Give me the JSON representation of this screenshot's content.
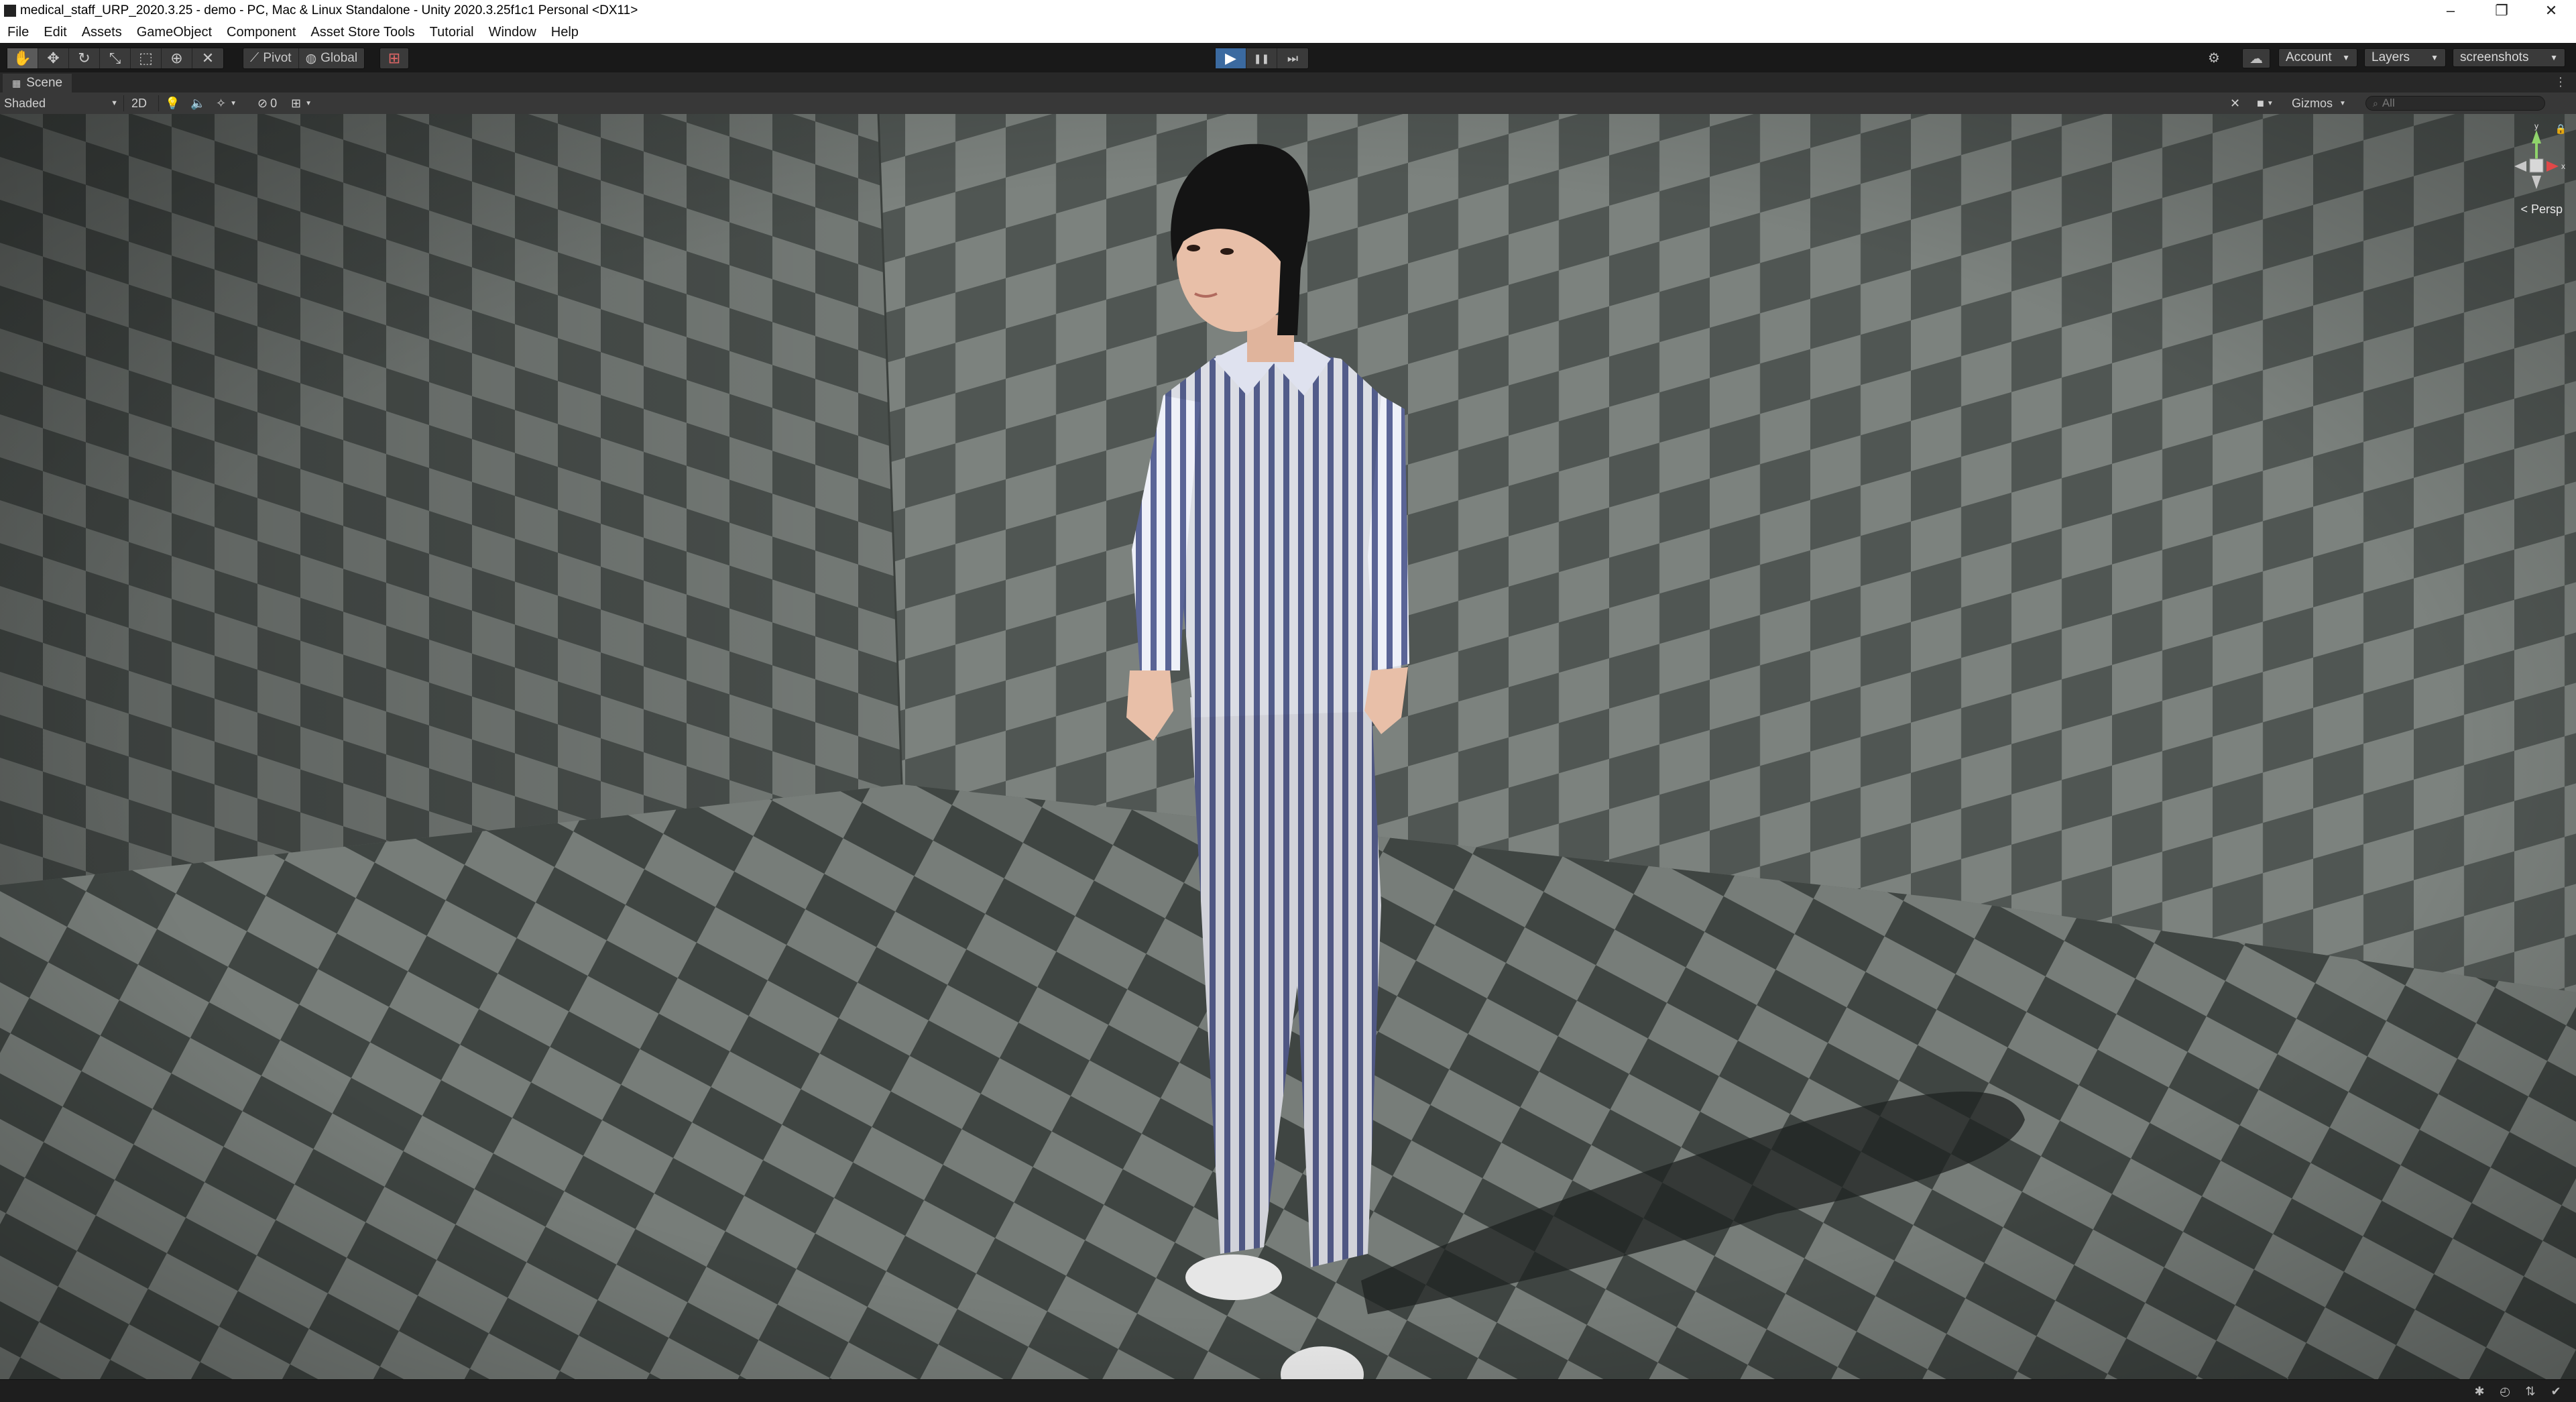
{
  "window": {
    "title": "medical_staff_URP_2020.3.25 - demo - PC, Mac & Linux Standalone - Unity 2020.3.25f1c1 Personal <DX11>",
    "controls": {
      "minimize": "–",
      "restore": "❐",
      "close": "✕"
    }
  },
  "menubar": {
    "items": [
      "File",
      "Edit",
      "Assets",
      "GameObject",
      "Component",
      "Asset Store Tools",
      "Tutorial",
      "Window",
      "Help"
    ]
  },
  "toolbar": {
    "tools": [
      {
        "name": "hand-tool-button",
        "icon": "hand-icon",
        "glyph": "✋",
        "active": true
      },
      {
        "name": "move-tool-button",
        "icon": "move-icon",
        "glyph": "✥",
        "active": false
      },
      {
        "name": "rotate-tool-button",
        "icon": "rotate-icon",
        "glyph": "↻",
        "active": false
      },
      {
        "name": "scale-tool-button",
        "icon": "scale-icon",
        "glyph": "⤡",
        "active": false
      },
      {
        "name": "rect-tool-button",
        "icon": "rect-icon",
        "glyph": "⬚",
        "active": false
      },
      {
        "name": "transform-tool-button",
        "icon": "transform-icon",
        "glyph": "⊕",
        "active": false
      },
      {
        "name": "custom-tool-button",
        "icon": "custom-tool-icon",
        "glyph": "✕",
        "active": false
      }
    ],
    "pivot_label": "Pivot",
    "global_label": "Global",
    "pivot_icon": "pivot-icon",
    "global_icon": "globe-icon",
    "grid_snap_icon": "grid-snap-icon",
    "play": {
      "icon": "play-icon",
      "glyph": "▶",
      "active": true
    },
    "pause": {
      "icon": "pause-icon",
      "glyph": "❚❚"
    },
    "step": {
      "icon": "step-icon",
      "glyph": "⏭"
    },
    "collab_icon": "collab-icon",
    "cloud_icon": "cloud-icon",
    "account_label": "Account",
    "layers_label": "Layers",
    "layout_label": "screenshots"
  },
  "scene_tab": {
    "label": "Scene",
    "icon": "scene-icon",
    "menu_icon": "kebab-menu-icon"
  },
  "scene_toolbar": {
    "draw_mode": "Shaded",
    "mode_2d": "2D",
    "lighting_icon": "lightbulb-icon",
    "audio_icon": "audio-icon",
    "effects_icon": "effects-icon",
    "hidden_count": "0",
    "visibility_icon": "eye-slash-icon",
    "grid_icon": "grid-icon",
    "tools_icon": "tools-icon",
    "camera_icon": "camera-icon",
    "gizmos_label": "Gizmos",
    "search_placeholder": "All",
    "search_icon": "search-icon"
  },
  "scene_view": {
    "character": "patient in striped pajamas",
    "gizmo": {
      "y_label": "y",
      "x_label": "x",
      "lock_icon": "lock-icon"
    },
    "projection_label": "< Persp",
    "colors": {
      "checker_light": "#7a807c",
      "checker_dark": "#4c524f",
      "stripe_blue": "#5a6496",
      "stripe_white": "#eef0f8",
      "hair": "#141414",
      "skin": "#e8bfa8"
    }
  },
  "statusbar": {
    "icons": [
      "bug-icon",
      "progress-icon",
      "network-icon",
      "check-icon"
    ]
  }
}
